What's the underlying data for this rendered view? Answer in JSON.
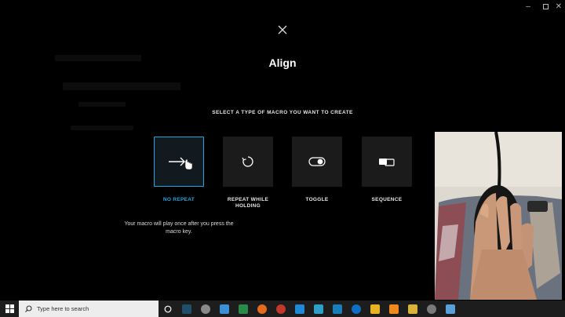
{
  "window": {
    "controls": [
      "minimize",
      "maximize",
      "close"
    ]
  },
  "dialog": {
    "title": "Align",
    "instruction": "SELECT A TYPE OF MACRO YOU WANT TO CREATE",
    "macro_types": [
      {
        "label": "NO REPEAT",
        "icon": "arrow-right-icon",
        "selected": true
      },
      {
        "label": "REPEAT WHILE HOLDING",
        "icon": "repeat-circle-icon",
        "selected": false
      },
      {
        "label": "TOGGLE",
        "icon": "toggle-switch-icon",
        "selected": false
      },
      {
        "label": "SEQUENCE",
        "icon": "sequence-icon",
        "selected": false
      }
    ],
    "description": "Your macro will play once after you press the macro key."
  },
  "taskbar": {
    "search_placeholder": "Type here to search",
    "apps": [
      "cortana-icon",
      "logitech-icon",
      "cloud-app-icon",
      "store-icon",
      "excel-icon",
      "firefox-icon",
      "settings-app-icon",
      "vscode-icon",
      "kobo-icon",
      "teamviewer-icon",
      "file-explorer-icon",
      "vlc-icon",
      "media-player-icon",
      "photos-icon",
      "document-icon"
    ]
  },
  "colors": {
    "accent": "#27a6de",
    "background": "#000000",
    "card": "#1b1b1b"
  }
}
